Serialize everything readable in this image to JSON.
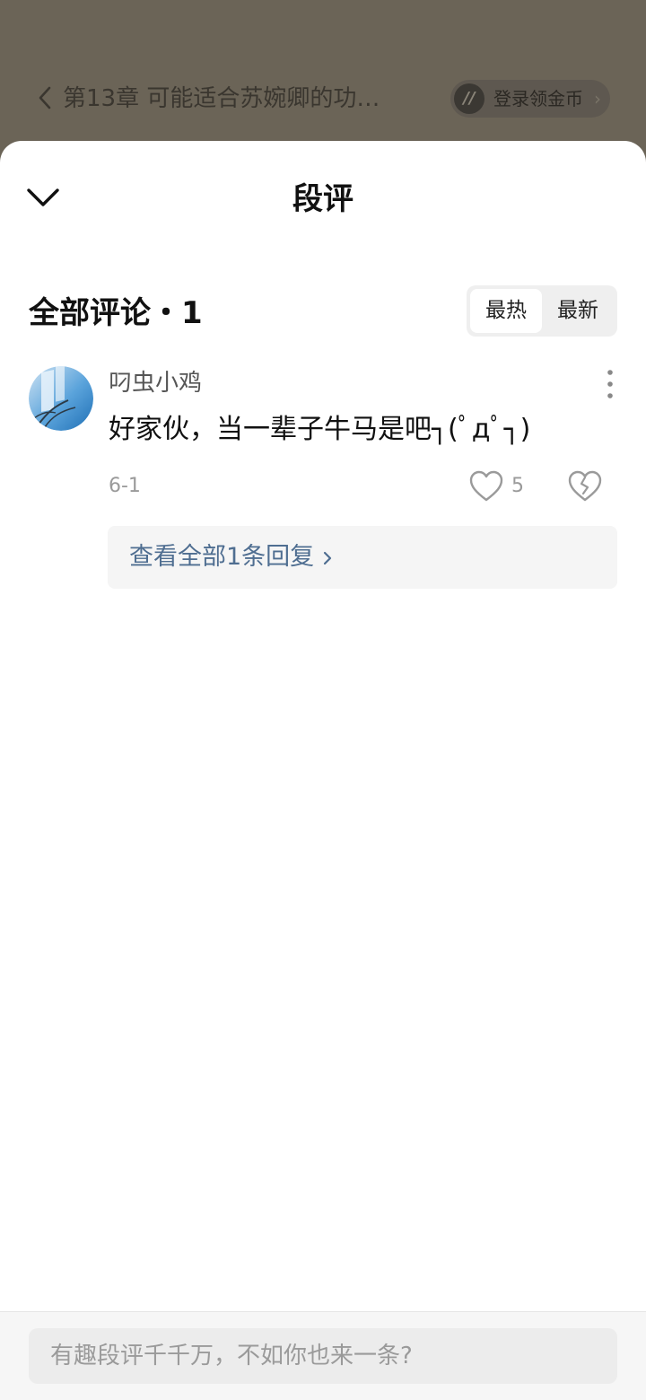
{
  "background_header": {
    "chapter_title": "第13章 可能适合苏婉卿的功…",
    "coin_button_label": "登录领金币"
  },
  "sheet": {
    "title": "段评",
    "comments_count_label": "全部评论・1",
    "sort_options": [
      "最热",
      "最新"
    ],
    "active_sort": "最热"
  },
  "comment": {
    "username": "叼虫小鸡",
    "text": "好家伙，当一辈子牛马是吧┐(ﾟдﾟ┐)",
    "date": "6-1",
    "like_count": "5",
    "view_replies_label": "查看全部1条回复"
  },
  "input": {
    "placeholder": "有趣段评千千万，不如你也来一条?"
  },
  "colors": {
    "overlay_bg": "#6b6457",
    "link_blue": "#4f6e91",
    "muted_gray": "#9a9a9a"
  }
}
